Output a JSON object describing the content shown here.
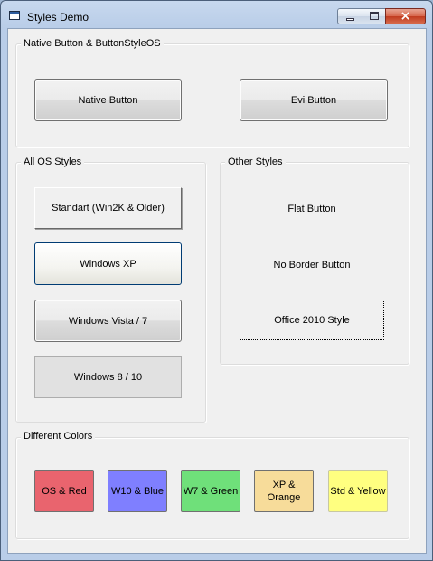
{
  "window": {
    "title": "Styles Demo",
    "controls": {
      "minimize": "minimize",
      "maximize": "maximize",
      "close": "×"
    }
  },
  "groups": {
    "native": {
      "label": "Native Button & ButtonStyleOS",
      "buttons": {
        "native": "Native Button",
        "evi": "Evi Button"
      }
    },
    "os": {
      "label": "All OS Styles",
      "buttons": {
        "standart": "Standart (Win2K & Older)",
        "xp": "Windows XP",
        "vista": "Windows Vista / 7",
        "win810": "Windows 8 / 10"
      }
    },
    "other": {
      "label": "Other Styles",
      "buttons": {
        "flat": "Flat Button",
        "noborder": "No Border Button",
        "office": "Office 2010 Style"
      }
    },
    "colors": {
      "label": "Different Colors",
      "buttons": {
        "os_red": "OS & Red",
        "w10_blue": "W10 & Blue",
        "w7_green": "W7 & Green",
        "xp_orange": "XP & Orange",
        "std_yellow": "Std & Yellow"
      }
    }
  },
  "colors": {
    "red": "#e9646e",
    "blue": "#7f7fff",
    "green": "#6fe07a",
    "orange": "#f7dc9a",
    "yellow": "#ffff80"
  }
}
